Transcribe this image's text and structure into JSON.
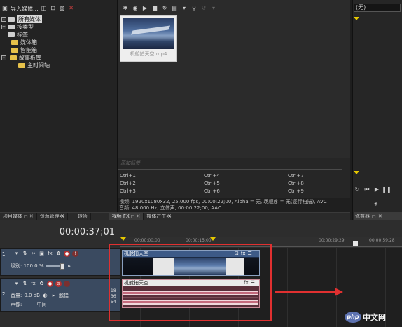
{
  "project_media": {
    "toolbar_label": "导入媒体...",
    "tree": [
      {
        "label": "所有媒体",
        "level": 1,
        "selected": true,
        "expander": "-"
      },
      {
        "label": "按类型",
        "level": 1,
        "selected": false,
        "expander": "+"
      },
      {
        "label": "标签",
        "level": 1,
        "selected": false,
        "expander": ""
      },
      {
        "label": "媒体箱",
        "level": 2,
        "selected": false,
        "expander": ""
      },
      {
        "label": "智能箱",
        "level": 2,
        "selected": false,
        "expander": ""
      },
      {
        "label": "故事板库",
        "level": 2,
        "selected": false,
        "expander": "-"
      },
      {
        "label": "主时间轴",
        "level": 3,
        "selected": false,
        "expander": ""
      }
    ]
  },
  "media_bin": {
    "thumbnail_caption": "机舱拍天空.mp4",
    "tag_placeholder": "添加标签",
    "shortcuts": [
      "Ctrl+1",
      "Ctrl+4",
      "Ctrl+7",
      "Ctrl+2",
      "Ctrl+5",
      "Ctrl+8",
      "Ctrl+3",
      "Ctrl+6",
      "Ctrl+9"
    ],
    "info_video": "视频: 1920x1080x32, 25.000 fps, 00:00:22;00, Alpha = 无, 场顺序 = 无(逐行扫描), AVC",
    "info_audio": "音频: 48,000 Hz, 立体声, 00:00:22;00, AAC"
  },
  "tabs": [
    {
      "label": "项目媒体",
      "active": false
    },
    {
      "label": "资源管理器",
      "active": false
    },
    {
      "label": "转场",
      "active": false
    },
    {
      "label": "视频 FX",
      "active": true
    },
    {
      "label": "媒体产生器",
      "active": false
    }
  ],
  "trimmer": {
    "select_value": "(无)",
    "tab_label": "修剪器"
  },
  "timeline": {
    "current_time": "00:00:37;01",
    "ruler_labels": [
      "00:00:00;00",
      "00:00:15;00",
      "00:00:29;29",
      "00:00:59;28"
    ],
    "video_track": {
      "number": "1",
      "level_label": "级别: 100.0 %",
      "clip_title": "机舱拍天空"
    },
    "audio_track": {
      "number": "2",
      "volume_label": "音量:",
      "volume_value": "0.0 dB",
      "pan_label": "声像:",
      "pan_value": "中间",
      "touch_label": "触摸",
      "clip_title": "机舱拍天空",
      "db_marks": [
        "18",
        "36",
        "54"
      ]
    }
  },
  "watermark": {
    "logo_text": "php",
    "site_text": "中文网"
  },
  "colors": {
    "annotation": "#e03030",
    "video_clip_header": "#3d5a87",
    "audio_clip_body": "#5a2f3a"
  }
}
